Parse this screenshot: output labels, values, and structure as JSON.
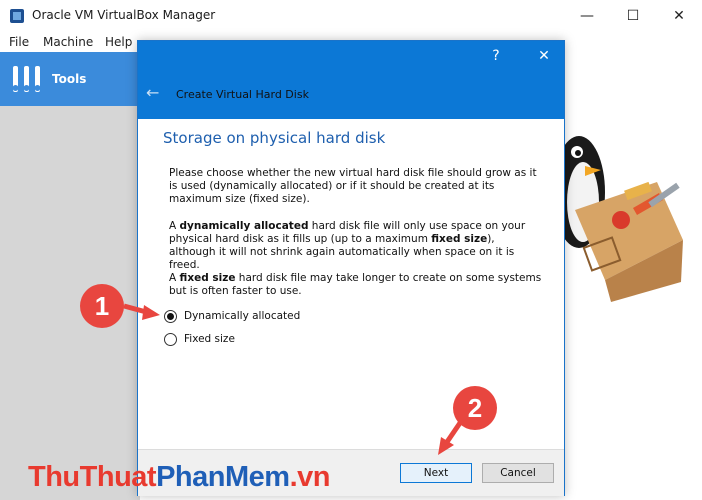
{
  "window": {
    "title": "Oracle VM VirtualBox Manager",
    "minimize": "—",
    "maximize": "☐",
    "close": "✕"
  },
  "menu": {
    "items": [
      "File",
      "Machine",
      "Help"
    ]
  },
  "sidebar": {
    "tools_label": "Tools"
  },
  "dialog": {
    "help_glyph": "?",
    "close_glyph": "✕",
    "back_glyph": "←",
    "header_title": "Create Virtual Hard Disk",
    "heading": "Storage on physical hard disk",
    "para1": "Please choose whether the new virtual hard disk file should grow as it is used (dynamically allocated) or if it should be created at its maximum size (fixed size).",
    "para2": {
      "p1": "A ",
      "b1": "dynamically allocated",
      "p2": " hard disk file will only use space on your physical hard disk as it fills up (up to a maximum ",
      "b2": "fixed size",
      "p3": "), although it will not shrink again automatically when space on it is freed."
    },
    "para3": {
      "p1": "A ",
      "b1": "fixed size",
      "p2": " hard disk file may take longer to create on some systems but is often faster to use."
    },
    "options": [
      {
        "label": "Dynamically allocated",
        "checked": true
      },
      {
        "label": "Fixed size",
        "checked": false
      }
    ],
    "next_label": "Next",
    "cancel_label": "Cancel"
  },
  "annotations": {
    "step1": "1",
    "step2": "2",
    "watermark": {
      "part1": "ThuThuat",
      "part2": "PhanMem",
      "part3": ".vn"
    }
  },
  "colors": {
    "accent": "#0c78d6",
    "sidebar_selected": "#3b8bdb",
    "callout": "#e8463f"
  }
}
